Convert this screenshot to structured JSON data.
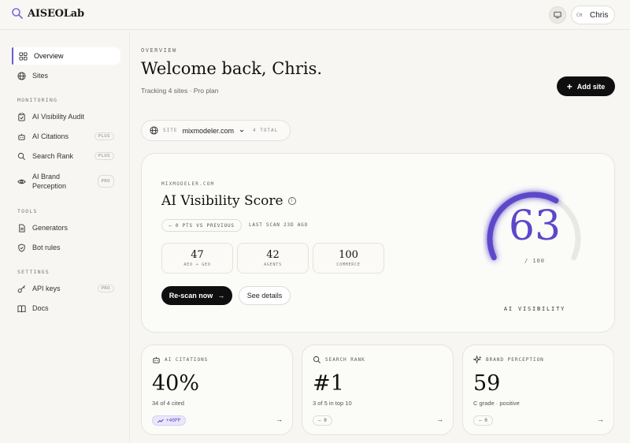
{
  "app": {
    "name": "AISEOLab"
  },
  "header": {
    "user_initials": "CH",
    "user_name": "Chris"
  },
  "sidebar": {
    "items": [
      {
        "label": "Overview",
        "icon": "grid-icon"
      },
      {
        "label": "Sites",
        "icon": "globe-icon"
      }
    ],
    "sections": [
      {
        "label": "MONITORING",
        "items": [
          {
            "label": "AI Visibility Audit",
            "icon": "clipboard-icon",
            "badge": ""
          },
          {
            "label": "AI Citations",
            "icon": "robot-icon",
            "badge": "PLUS"
          },
          {
            "label": "Search Rank",
            "icon": "search-icon",
            "badge": "PLUS"
          },
          {
            "label": "AI Brand Perception",
            "icon": "eye-icon",
            "badge": "PRO"
          }
        ]
      },
      {
        "label": "TOOLS",
        "items": [
          {
            "label": "Generators",
            "icon": "document-icon",
            "badge": ""
          },
          {
            "label": "Bot rules",
            "icon": "shield-icon",
            "badge": ""
          }
        ]
      },
      {
        "label": "SETTINGS",
        "items": [
          {
            "label": "API keys",
            "icon": "key-icon",
            "badge": "PRO"
          },
          {
            "label": "Docs",
            "icon": "book-icon",
            "badge": ""
          }
        ]
      }
    ]
  },
  "main": {
    "overview_label": "OVERVIEW",
    "welcome": "Welcome back, Chris.",
    "tracking": "Tracking 4 sites · Pro plan",
    "add_site": "Add site",
    "site_selector": {
      "label": "SITE",
      "value": "mixmodeler.com",
      "total": "4 TOTAL"
    }
  },
  "score_card": {
    "domain": "MIXMODELER.COM",
    "title": "AI Visibility Score",
    "delta": "— 0 PTS VS PREVIOUS",
    "last_scan": "LAST SCAN 23D AGO",
    "stats": [
      {
        "value": "47",
        "caption": "AEO + GEO"
      },
      {
        "value": "42",
        "caption": "AGENTS"
      },
      {
        "value": "100",
        "caption": "COMMERCE"
      }
    ],
    "rescan": "Re-scan now",
    "details": "See details",
    "score": "63",
    "score_value": 63,
    "score_max_text": "/ 100",
    "score_max": 100,
    "gauge_label": "AI VISIBILITY",
    "accent": "#5b48c9"
  },
  "cards": [
    {
      "head": "AI CITATIONS",
      "icon": "robot-icon",
      "value": "40%",
      "sub": "34 of 4 cited",
      "chip": "+40PP",
      "chip_up": true
    },
    {
      "head": "SEARCH RANK",
      "icon": "search-icon",
      "value": "#1",
      "sub": "3 of 5 in top 10",
      "chip": "— 0",
      "chip_up": false
    },
    {
      "head": "BRAND PERCEPTION",
      "icon": "sparkle-icon",
      "value": "59",
      "sub": "C grade · positive",
      "chip": "— 0",
      "chip_up": false
    }
  ]
}
